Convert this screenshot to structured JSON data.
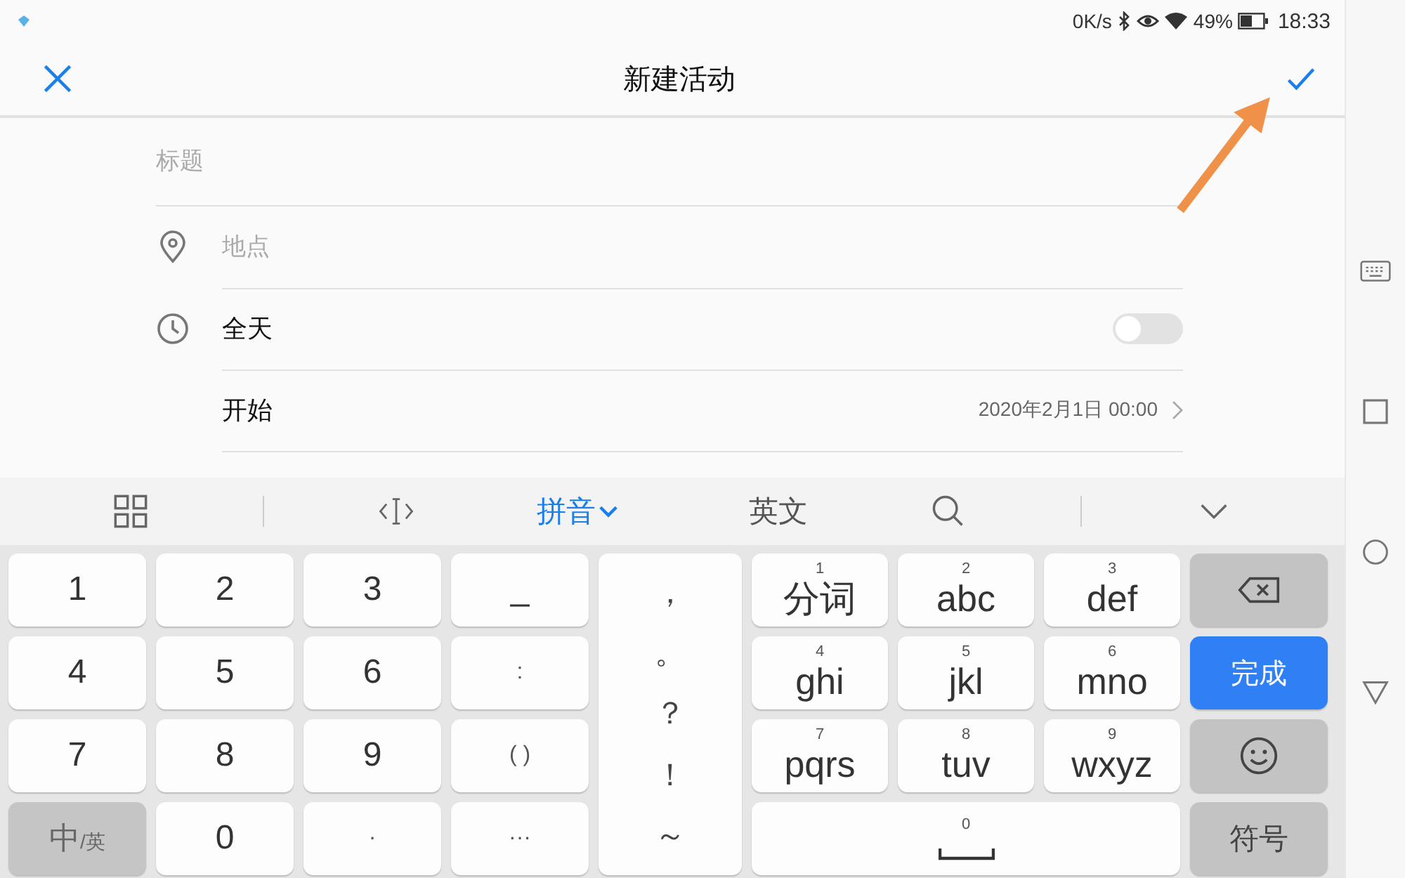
{
  "status_bar": {
    "speed": "0K/s",
    "battery": "49%",
    "time": "18:33"
  },
  "app_bar": {
    "title": "新建活动"
  },
  "form": {
    "title_placeholder": "标题",
    "location_placeholder": "地点",
    "all_day": {
      "label": "全天",
      "on": false
    },
    "start": {
      "label": "开始",
      "value": "2020年2月1日 00:00"
    }
  },
  "keyboard": {
    "modes": [
      {
        "label": "拼音",
        "selected": true
      },
      {
        "label": "英文",
        "selected": false
      }
    ],
    "number_keys": [
      {
        "label": "1",
        "kind": "plain"
      },
      {
        "label": "2",
        "kind": "plain"
      },
      {
        "label": "3",
        "kind": "plain"
      },
      {
        "label": "_",
        "kind": "plain"
      },
      {
        "label": "4",
        "kind": "plain"
      },
      {
        "label": "5",
        "kind": "plain"
      },
      {
        "label": "6",
        "kind": "plain"
      },
      {
        "label": ":",
        "kind": "small"
      },
      {
        "label": "7",
        "kind": "plain"
      },
      {
        "label": "8",
        "kind": "plain"
      },
      {
        "label": "9",
        "kind": "plain"
      },
      {
        "label": "( )",
        "kind": "small"
      },
      {
        "label": "中",
        "sublabel": "/英",
        "kind": "switch"
      },
      {
        "label": "0",
        "kind": "plain"
      },
      {
        "label": "·",
        "kind": "small"
      },
      {
        "label": "···",
        "kind": "small"
      }
    ],
    "punctuation": [
      "，",
      "。",
      "？",
      "！",
      "～"
    ],
    "t9_keys": [
      {
        "digit": "1",
        "label": "分词"
      },
      {
        "digit": "2",
        "label": "abc"
      },
      {
        "digit": "3",
        "label": "def"
      },
      {
        "digit": "4",
        "label": "ghi"
      },
      {
        "digit": "5",
        "label": "jkl"
      },
      {
        "digit": "6",
        "label": "mno"
      },
      {
        "digit": "7",
        "label": "pqrs"
      },
      {
        "digit": "8",
        "label": "tuv"
      },
      {
        "digit": "9",
        "label": "wxyz"
      }
    ],
    "space_key": {
      "digit": "0"
    },
    "action_keys": [
      {
        "kind": "backspace"
      },
      {
        "kind": "done",
        "label": "完成"
      },
      {
        "kind": "emoji"
      },
      {
        "kind": "symbols",
        "label": "符号"
      }
    ]
  }
}
